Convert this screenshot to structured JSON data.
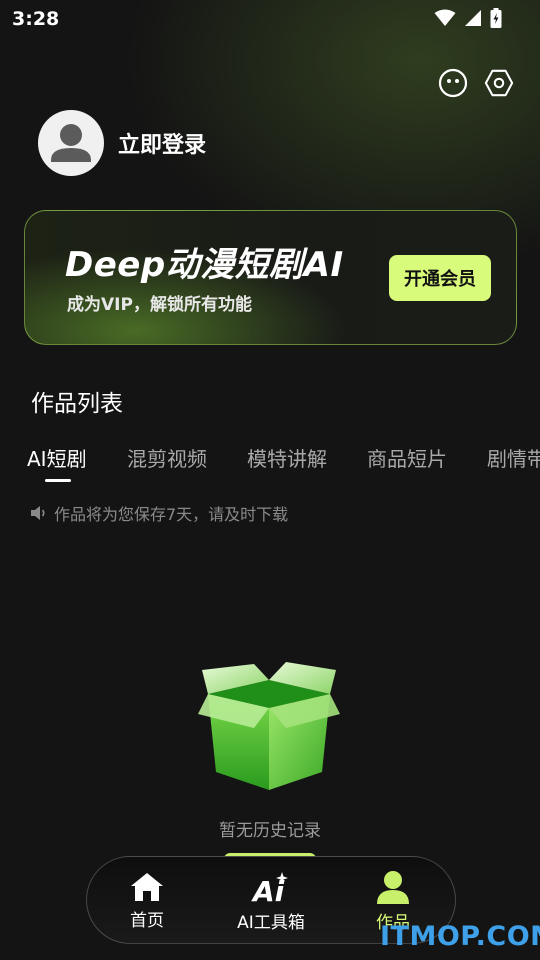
{
  "status_bar": {
    "time": "3:28"
  },
  "profile": {
    "login_label": "立即登录"
  },
  "vip_banner": {
    "title": "Deep动漫短剧AI",
    "subtitle": "成为VIP，解锁所有功能",
    "button_label": "开通会员"
  },
  "works": {
    "section_title": "作品列表",
    "tabs": [
      {
        "label": "AI短剧",
        "active": true
      },
      {
        "label": "混剪视频",
        "active": false
      },
      {
        "label": "模特讲解",
        "active": false
      },
      {
        "label": "商品短片",
        "active": false
      },
      {
        "label": "剧情带",
        "active": false
      }
    ],
    "notice": "作品将为您保存7天，请及时下载",
    "empty_text": "暂无历史记录"
  },
  "bottom_nav": {
    "items": [
      {
        "label": "首页",
        "icon": "home-icon"
      },
      {
        "label": "AI工具箱",
        "icon": "ai-sparkle-icon"
      },
      {
        "label": "作品",
        "icon": "person-icon",
        "active": true
      }
    ]
  },
  "watermark": "ITMOP.COM",
  "colors": {
    "accent": "#d9fb7c",
    "active_nav": "#d6f876",
    "background": "#141414"
  }
}
